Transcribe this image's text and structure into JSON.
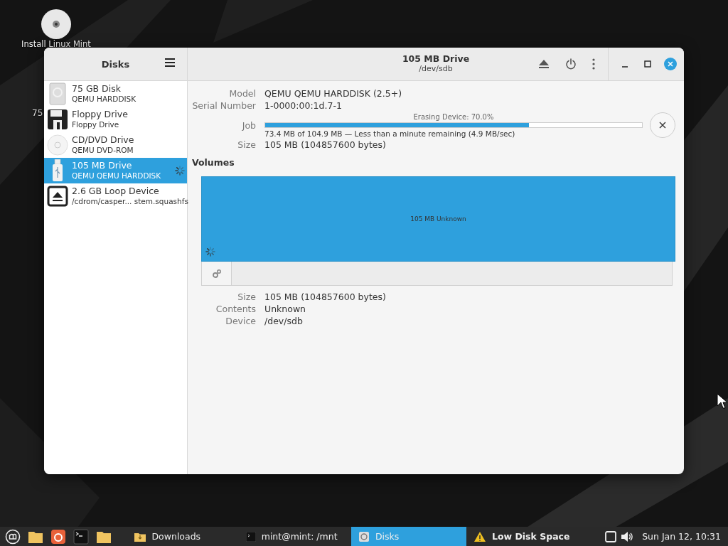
{
  "desktop": {
    "icons": [
      {
        "kind": "disc",
        "label": "Install Linux Mint"
      },
      {
        "kind": "text",
        "label": "75"
      }
    ]
  },
  "window": {
    "sidebar_title": "Disks",
    "title": "105 MB Drive",
    "subtitle": "/dev/sdb"
  },
  "drives": [
    {
      "kind": "harddisk",
      "name": "75 GB Disk",
      "model": "QEMU HARDDISK",
      "selected": false,
      "busy": false
    },
    {
      "kind": "floppy",
      "name": "Floppy Drive",
      "model": "Floppy Drive",
      "selected": false,
      "busy": false
    },
    {
      "kind": "optical",
      "name": "CD/DVD Drive",
      "model": "QEMU DVD-ROM",
      "selected": false,
      "busy": false
    },
    {
      "kind": "usb",
      "name": "105 MB Drive",
      "model": "QEMU QEMU HARDDISK",
      "selected": true,
      "busy": true
    },
    {
      "kind": "loop",
      "name": "2.6 GB Loop Device",
      "model": "/cdrom/casper... stem.squashfs",
      "selected": false,
      "busy": false
    }
  ],
  "drive_info": [
    {
      "kind": "text",
      "label": "Model",
      "value": "QEMU QEMU HARDDISK (2.5+)"
    },
    {
      "kind": "text",
      "label": "Serial Number",
      "value": "1-0000:00:1d.7-1"
    },
    {
      "kind": "job",
      "label": "Job",
      "caption": "Erasing Device: 70.0%",
      "level": 0.7,
      "detail": "73.4 MB of 104.9 MB — Less than a minute remaining (4.9 MB/sec)"
    },
    {
      "kind": "text",
      "label": "Size",
      "value": "105 MB (104857600 bytes)"
    }
  ],
  "volumes": {
    "heading": "Volumes",
    "partitions": [
      {
        "label": "105 MB Unknown",
        "selected": true,
        "busy": true
      }
    ],
    "details": [
      {
        "label": "Size",
        "value": "105 MB (104857600 bytes)"
      },
      {
        "label": "Contents",
        "value": "Unknown"
      },
      {
        "label": "Device",
        "value": "/dev/sdb"
      }
    ]
  },
  "taskbar": {
    "launchers": [
      {
        "kind": "menu"
      },
      {
        "kind": "folder"
      },
      {
        "kind": "browser"
      },
      {
        "kind": "terminal"
      },
      {
        "kind": "folder"
      }
    ],
    "tasks": [
      {
        "kind": "folder",
        "label": "Downloads",
        "selected": false
      },
      {
        "kind": "terminal",
        "label": "mint@mint: /mnt",
        "selected": false
      },
      {
        "kind": "disks",
        "label": "Disks",
        "selected": true
      },
      {
        "kind": "warning",
        "label": "Low Disk Space",
        "selected": false
      }
    ],
    "clock": "Sun Jan 12, 10:31"
  }
}
